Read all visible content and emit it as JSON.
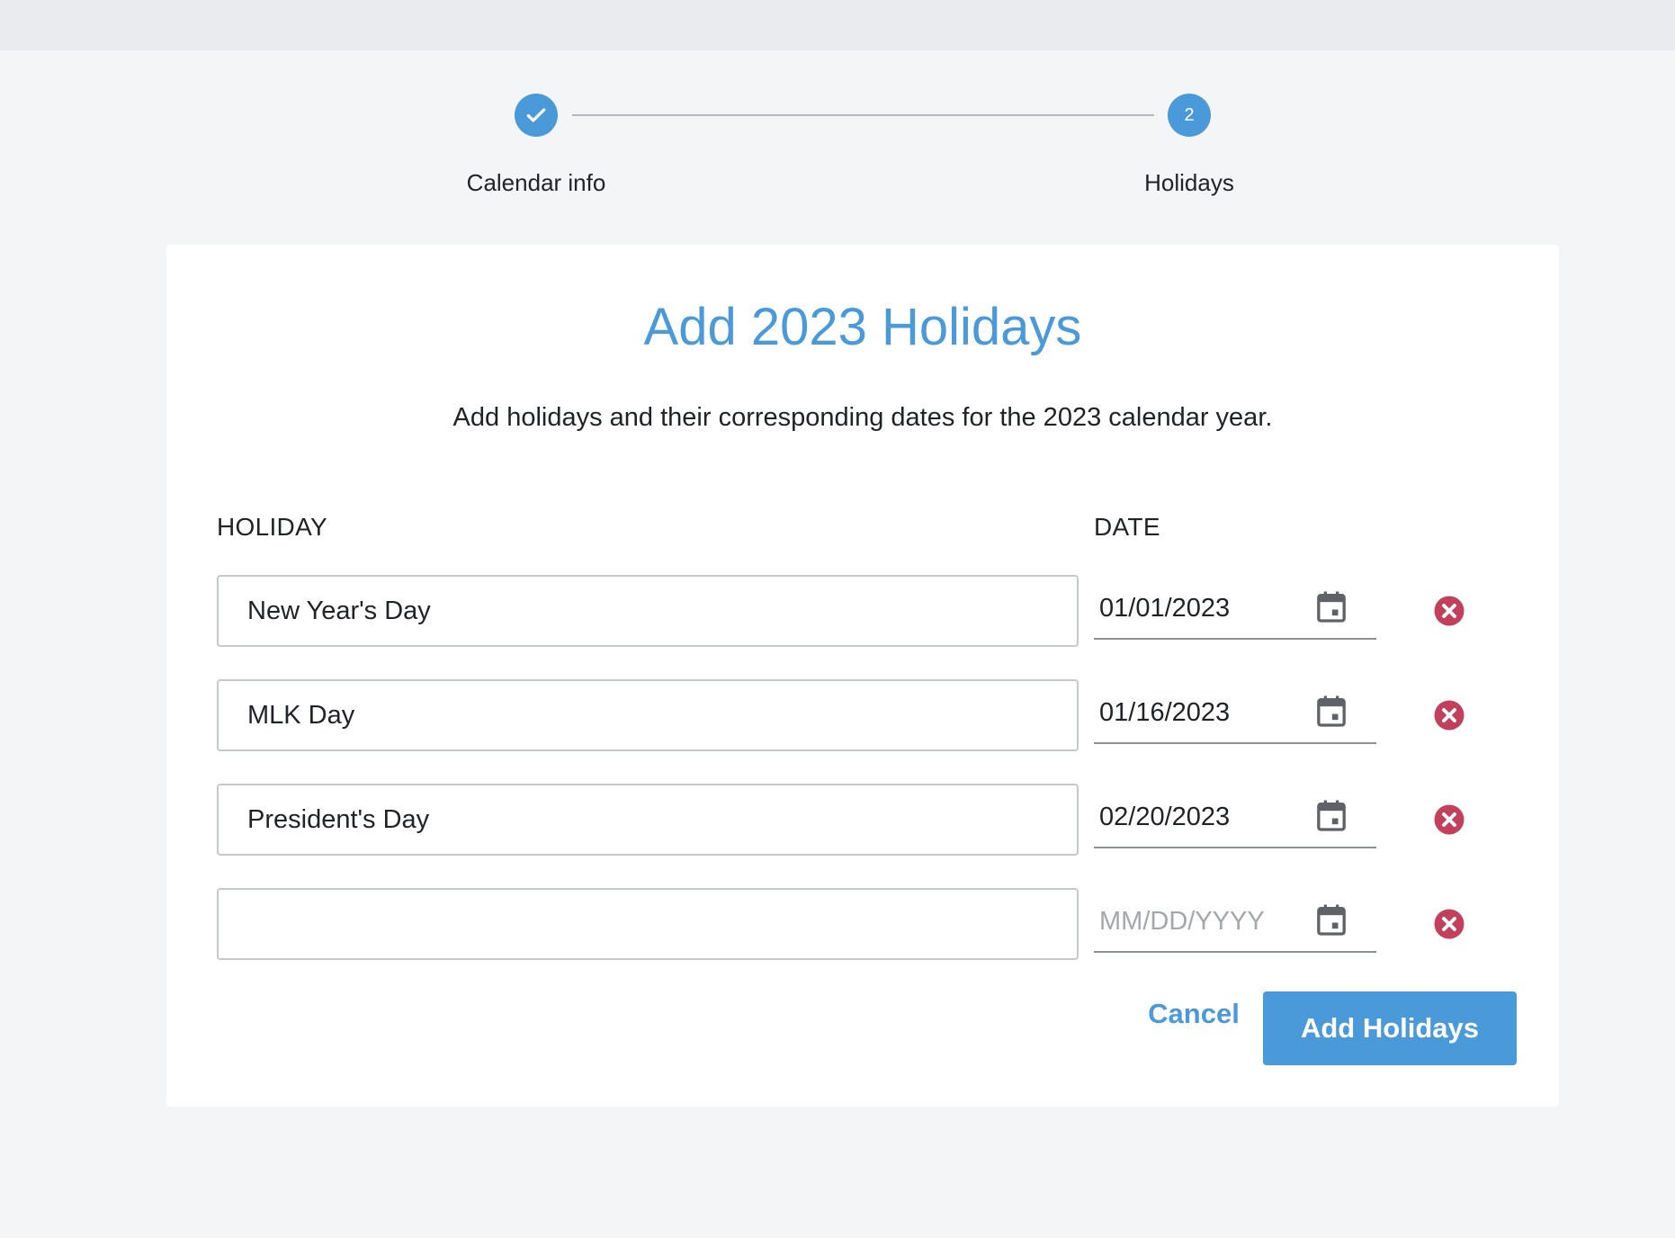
{
  "stepper": {
    "steps": [
      {
        "label": "Calendar info",
        "status": "complete",
        "icon": "check-icon"
      },
      {
        "label": "Holidays",
        "status": "current",
        "number": "2"
      }
    ]
  },
  "dialog": {
    "title": "Add 2023 Holidays",
    "subtitle": "Add holidays and their corresponding dates for the 2023 calendar year.",
    "columns": {
      "holiday": "HOLIDAY",
      "date": "DATE"
    },
    "rows": [
      {
        "holiday": "New Year's Day",
        "date": "01/01/2023"
      },
      {
        "holiday": "MLK Day",
        "date": "01/16/2023"
      },
      {
        "holiday": "President's Day",
        "date": "02/20/2023"
      },
      {
        "holiday": "",
        "date": ""
      }
    ],
    "date_placeholder": "MM/DD/YYYY",
    "cancel_label": "Cancel",
    "submit_label": "Add Holidays"
  },
  "colors": {
    "accent": "#4a9ad9",
    "remove": "#c3405d",
    "background": "#f3f5f7"
  },
  "icons": {
    "calendar": "calendar-icon",
    "remove": "remove-circle-icon"
  }
}
